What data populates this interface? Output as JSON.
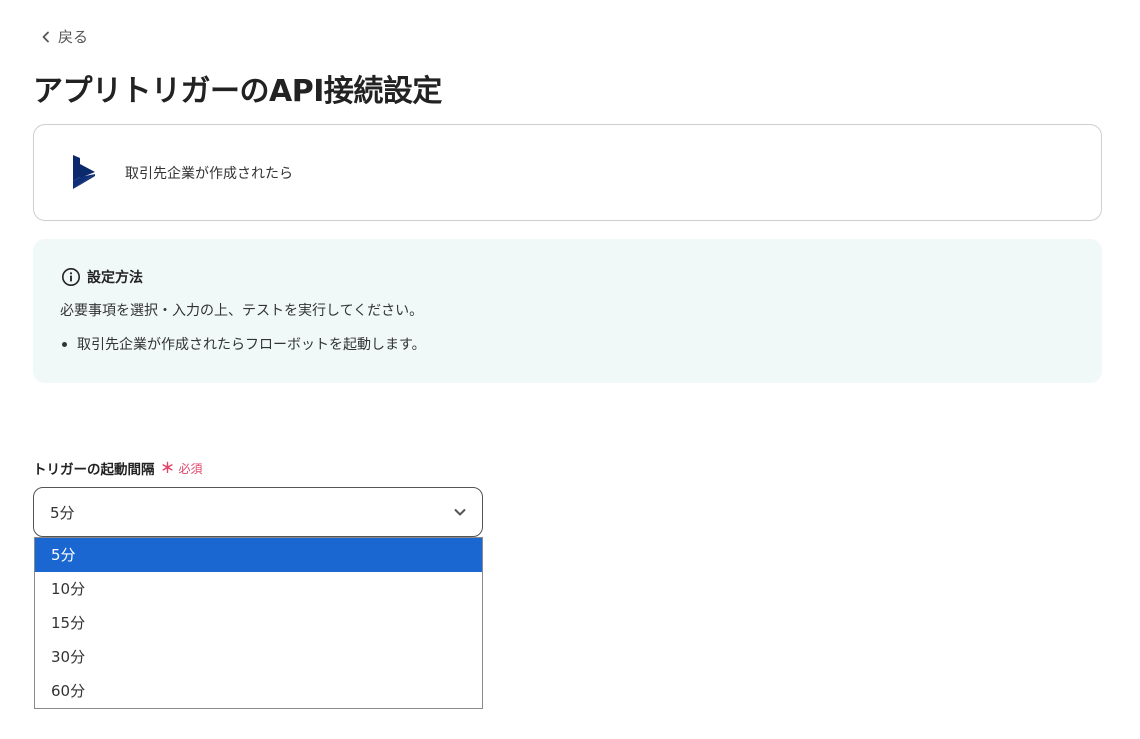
{
  "nav": {
    "back_label": "戻る"
  },
  "page": {
    "title": "アプリトリガーのAPI接続設定"
  },
  "app_card": {
    "logo_icon": "dynamics-365-logo-icon",
    "event_label": "取引先企業が作成されたら"
  },
  "info": {
    "heading": "設定方法",
    "description": "必要事項を選択・入力の上、テストを実行してください。",
    "bullets": [
      "取引先企業が作成されたらフローボットを起動します。"
    ]
  },
  "trigger_interval": {
    "label": "トリガーの起動間隔",
    "required_mark": "＊",
    "required_text": "必須",
    "selected_value": "5分",
    "options": [
      "5分",
      "10分",
      "15分",
      "30分",
      "60分"
    ],
    "selected_index": 0
  },
  "colors": {
    "accent": "#1a67d2",
    "required": "#e2456b",
    "info_bg": "#f1f8f8",
    "logo": "#0b2a6b"
  }
}
